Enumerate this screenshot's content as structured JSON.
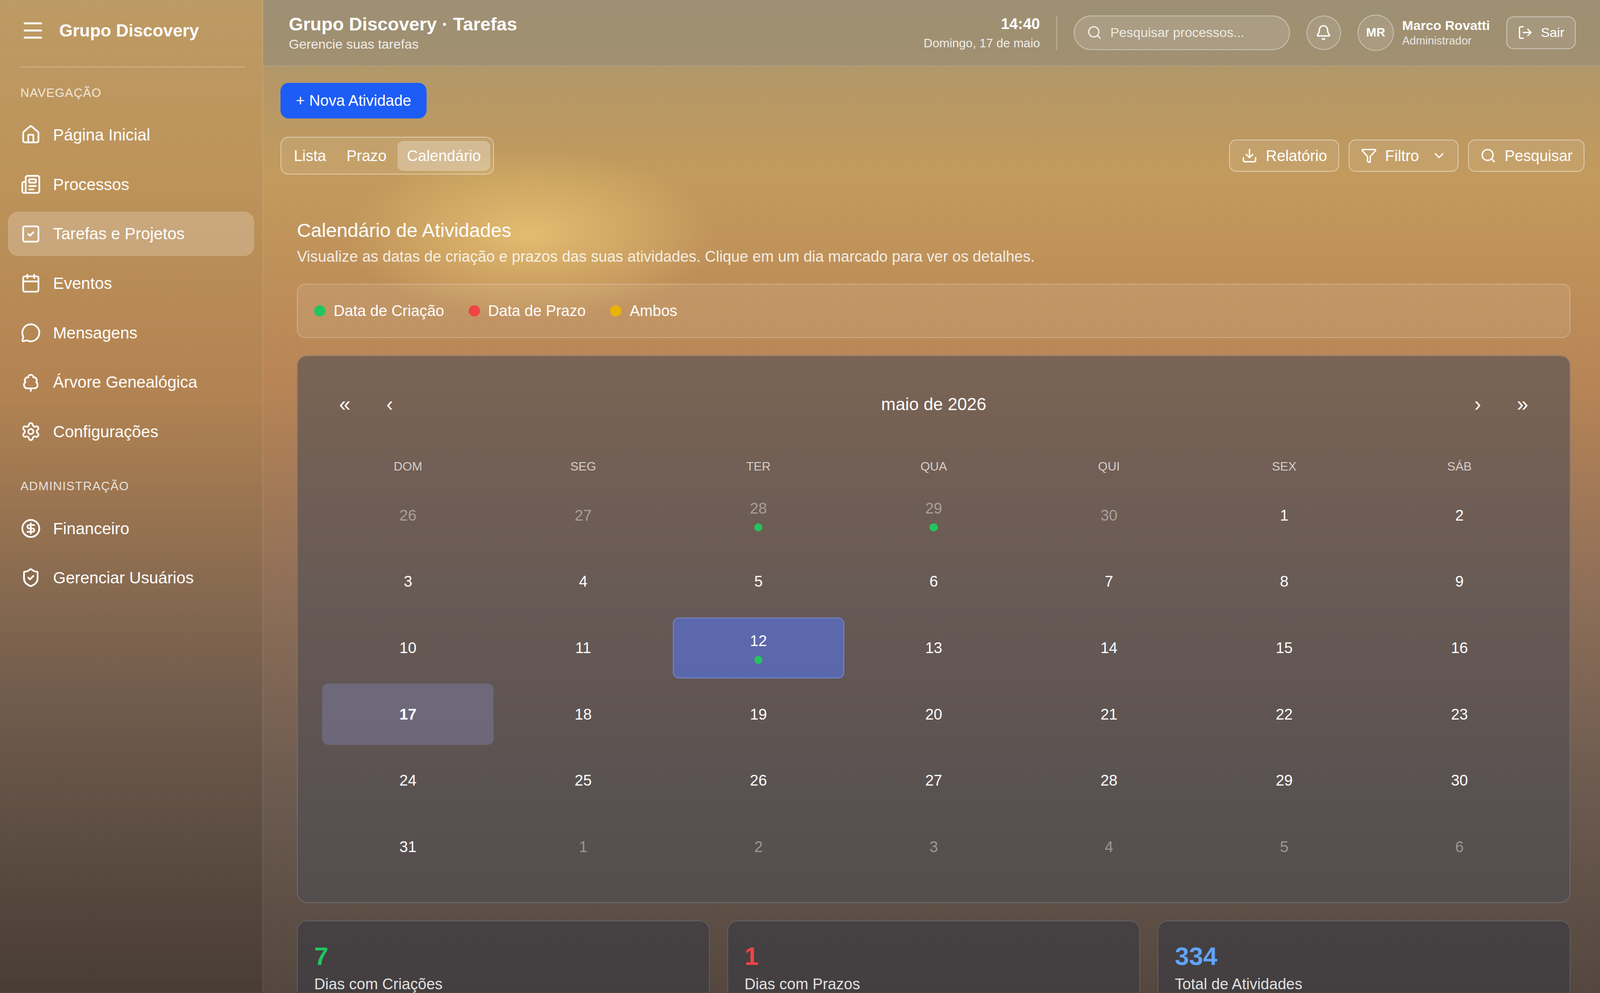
{
  "brand": "Grupo Discovery",
  "menu_icon": "",
  "sidebar": {
    "sections": [
      {
        "label": "NAVEGAÇÃO",
        "items": [
          {
            "label": "Página Inicial",
            "selected": false
          },
          {
            "label": "Processos",
            "selected": false
          },
          {
            "label": "Tarefas e Projetos",
            "selected": true
          },
          {
            "label": "Eventos",
            "selected": false
          },
          {
            "label": "Mensagens",
            "selected": false
          },
          {
            "label": "Árvore Genealógica",
            "selected": false
          },
          {
            "label": "Configurações",
            "selected": false
          }
        ]
      },
      {
        "label": "ADMINISTRAÇÃO",
        "items": [
          {
            "label": "Financeiro",
            "selected": false
          },
          {
            "label": "Gerenciar Usuários",
            "selected": false
          }
        ]
      }
    ]
  },
  "header": {
    "title": "Grupo Discovery · Tarefas",
    "subtitle": "Gerencie suas tarefas",
    "time": "14:40",
    "date": "Domingo, 17 de maio",
    "search": {
      "placeholder": "Pesquisar processos..."
    },
    "user": {
      "initials": "MR",
      "name": "Marco Rovatti",
      "role": "Administrador"
    },
    "logout": "Sair"
  },
  "new_button": "+ Nova Atividade",
  "tabs": [
    {
      "label": "Lista",
      "selected": false
    },
    {
      "label": "Prazo",
      "selected": false
    },
    {
      "label": "Calendário",
      "selected": true
    }
  ],
  "toolbar": [
    "Relatório",
    "Filtro",
    "Pesquisar"
  ],
  "calendar": {
    "title": "Calendário de Atividades",
    "description": "Visualize as datas de criação e prazos das suas atividades. Clique em um dia marcado para ver os detalhes.",
    "legend": [
      {
        "label": "Data de Criação",
        "color": "#22c55e"
      },
      {
        "label": "Data de Prazo",
        "color": "#ef4444"
      },
      {
        "label": "Ambos",
        "color": "#eab308"
      }
    ],
    "month": "maio de 2026",
    "nav": [
      "«",
      "‹",
      "›",
      "»"
    ],
    "weekdays": [
      "DOM",
      "SEG",
      "TER",
      "QUA",
      "QUI",
      "SEX",
      "SÁB"
    ],
    "days": [
      {
        "label": "26",
        "outside": true,
        "today": false,
        "selected": false
      },
      {
        "label": "27",
        "outside": true,
        "today": false,
        "selected": false
      },
      {
        "label": "28",
        "outside": true,
        "today": false,
        "selected": false,
        "color": "#22c55e"
      },
      {
        "label": "29",
        "outside": true,
        "today": false,
        "selected": false,
        "color": "#22c55e"
      },
      {
        "label": "30",
        "outside": true,
        "today": false,
        "selected": false
      },
      {
        "label": "1",
        "outside": false,
        "today": false,
        "selected": false
      },
      {
        "label": "2",
        "outside": false,
        "today": false,
        "selected": false
      },
      {
        "label": "3",
        "outside": false,
        "today": false,
        "selected": false
      },
      {
        "label": "4",
        "outside": false,
        "today": false,
        "selected": false
      },
      {
        "label": "5",
        "outside": false,
        "today": false,
        "selected": false
      },
      {
        "label": "6",
        "outside": false,
        "today": false,
        "selected": false
      },
      {
        "label": "7",
        "outside": false,
        "today": false,
        "selected": false
      },
      {
        "label": "8",
        "outside": false,
        "today": false,
        "selected": false
      },
      {
        "label": "9",
        "outside": false,
        "today": false,
        "selected": false
      },
      {
        "label": "10",
        "outside": false,
        "today": false,
        "selected": false
      },
      {
        "label": "11",
        "outside": false,
        "today": false,
        "selected": false
      },
      {
        "label": "12",
        "outside": false,
        "today": false,
        "selected": true,
        "color": "#22c55e"
      },
      {
        "label": "13",
        "outside": false,
        "today": false,
        "selected": false
      },
      {
        "label": "14",
        "outside": false,
        "today": false,
        "selected": false
      },
      {
        "label": "15",
        "outside": false,
        "today": false,
        "selected": false
      },
      {
        "label": "16",
        "outside": false,
        "today": false,
        "selected": false
      },
      {
        "label": "17",
        "outside": false,
        "today": true,
        "selected": false
      },
      {
        "label": "18",
        "outside": false,
        "today": false,
        "selected": false
      },
      {
        "label": "19",
        "outside": false,
        "today": false,
        "selected": false
      },
      {
        "label": "20",
        "outside": false,
        "today": false,
        "selected": false
      },
      {
        "label": "21",
        "outside": false,
        "today": false,
        "selected": false
      },
      {
        "label": "22",
        "outside": false,
        "today": false,
        "selected": false
      },
      {
        "label": "23",
        "outside": false,
        "today": false,
        "selected": false
      },
      {
        "label": "24",
        "outside": false,
        "today": false,
        "selected": false
      },
      {
        "label": "25",
        "outside": false,
        "today": false,
        "selected": false
      },
      {
        "label": "26",
        "outside": false,
        "today": false,
        "selected": false
      },
      {
        "label": "27",
        "outside": false,
        "today": false,
        "selected": false
      },
      {
        "label": "28",
        "outside": false,
        "today": false,
        "selected": false
      },
      {
        "label": "29",
        "outside": false,
        "today": false,
        "selected": false
      },
      {
        "label": "30",
        "outside": false,
        "today": false,
        "selected": false
      },
      {
        "label": "31",
        "outside": false,
        "today": false,
        "selected": false
      },
      {
        "label": "1",
        "outside": true,
        "today": false,
        "selected": false
      },
      {
        "label": "2",
        "outside": true,
        "today": false,
        "selected": false
      },
      {
        "label": "3",
        "outside": true,
        "today": false,
        "selected": false
      },
      {
        "label": "4",
        "outside": true,
        "today": false,
        "selected": false
      },
      {
        "label": "5",
        "outside": true,
        "today": false,
        "selected": false
      },
      {
        "label": "6",
        "outside": true,
        "today": false,
        "selected": false
      }
    ]
  },
  "stats": [
    {
      "value": "7",
      "label": "Dias com Criações",
      "color": "#22c55e"
    },
    {
      "value": "1",
      "label": "Dias com Prazos",
      "color": "#ef4444"
    },
    {
      "value": "334",
      "label": "Total de Atividades",
      "color": "#60a5fa"
    }
  ]
}
